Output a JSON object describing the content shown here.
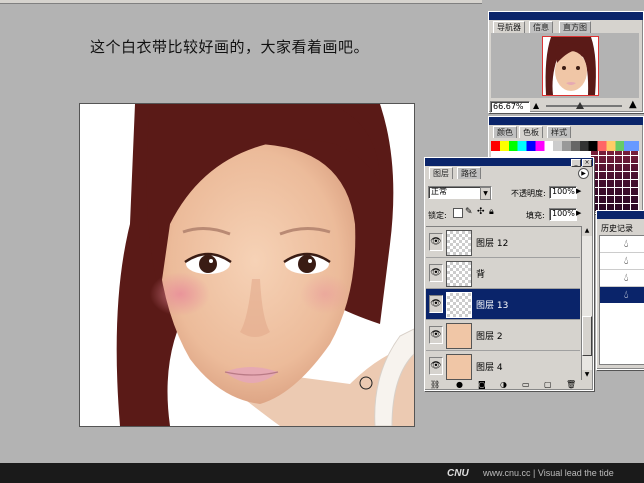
{
  "caption": "这个白衣带比较好画的，大家看着画吧。",
  "navigator": {
    "tabs": [
      "导航器",
      "信息",
      "直方图"
    ],
    "zoom": "66.67%"
  },
  "color_panel": {
    "tabs": [
      "颜色",
      "色板",
      "样式"
    ]
  },
  "layers_panel": {
    "tabs": [
      "图层",
      "路径"
    ],
    "blend_mode": "正常",
    "opacity_label": "不透明度:",
    "opacity_value": "100%",
    "lock_label": "锁定:",
    "fill_label": "填充:",
    "fill_value": "100%",
    "layers": [
      {
        "name": "图层 12",
        "selected": false
      },
      {
        "name": "背",
        "selected": false
      },
      {
        "name": "图层 13",
        "selected": true
      },
      {
        "name": "图层 2",
        "selected": false
      },
      {
        "name": "图层 4",
        "selected": false
      }
    ]
  },
  "history_panel": {
    "title": "历史记录"
  },
  "footer": {
    "logo": "CNU",
    "text": "www.cnu.cc | Visual lead the tide"
  },
  "colors": {
    "hair": "#5a1a17",
    "skin": "#f0c6a6",
    "selection": "#0a246a",
    "titlebar": "#0a246a",
    "workspace": "#b3b3b3"
  }
}
